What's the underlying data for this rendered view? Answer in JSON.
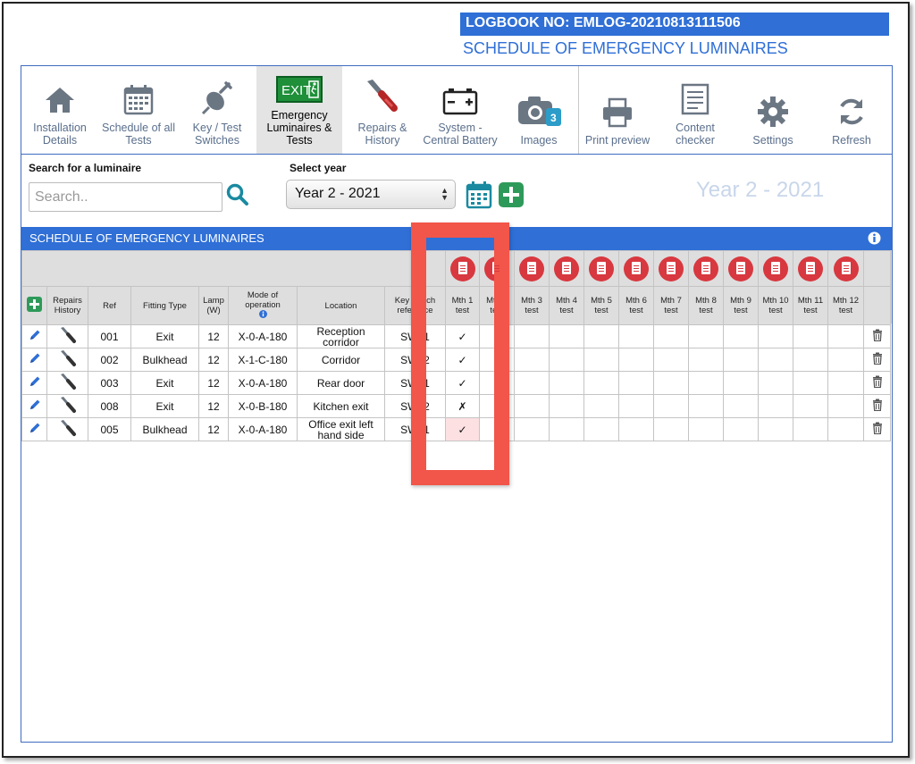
{
  "header": {
    "logbook": "LOGBOOK NO: EMLOG-20210813111506",
    "title": "SCHEDULE OF EMERGENCY LUMINAIRES"
  },
  "toolbar": {
    "items": [
      {
        "label": "Installation Details",
        "icon": "house-icon"
      },
      {
        "label": "Schedule of all Tests",
        "icon": "calendar-icon"
      },
      {
        "label": "Key / Test Switches",
        "icon": "key-switch-icon"
      },
      {
        "label": "Emergency Luminaires & Tests",
        "icon": "exit-sign-icon",
        "active": true
      },
      {
        "label": "Repairs & History",
        "icon": "screwdriver-icon"
      },
      {
        "label": "System - Central Battery",
        "icon": "battery-icon"
      },
      {
        "label": "Images",
        "icon": "camera-icon",
        "badge": "3"
      },
      {
        "label": "Print preview",
        "icon": "printer-icon"
      },
      {
        "label": "Content checker",
        "icon": "checklist-icon"
      },
      {
        "label": "Settings",
        "icon": "gear-icon"
      },
      {
        "label": "Refresh",
        "icon": "refresh-icon"
      }
    ],
    "exit_sign_text": "EXIT"
  },
  "search": {
    "label": "Search for a luminaire",
    "placeholder": "Search.."
  },
  "year": {
    "label": "Select year",
    "selected": "Year 2 - 2021",
    "display": "Year 2 - 2021"
  },
  "section": {
    "title": "SCHEDULE OF EMERGENCY LUMINAIRES"
  },
  "table": {
    "headers": {
      "repairs_history": "Repairs History",
      "ref": "Ref",
      "fitting_type": "Fitting Type",
      "lamp": "Lamp (W)",
      "mode": "Mode of operation",
      "location": "Location",
      "key_switch": "Key switch reference"
    },
    "months": [
      "Mth 1 test",
      "Mth 2 test",
      "Mth 3 test",
      "Mth 4 test",
      "Mth 5 test",
      "Mth 6 test",
      "Mth 7 test",
      "Mth 8 test",
      "Mth 9 test",
      "Mth 10 test",
      "Mth 11 test",
      "Mth 12 test"
    ],
    "rows": [
      {
        "ref": "001",
        "type": "Exit",
        "lamp": "12",
        "mode": "X-0-A-180",
        "location": "Reception corridor",
        "switch": "SW01",
        "m1": "✓",
        "m1_status": "pass"
      },
      {
        "ref": "002",
        "type": "Bulkhead",
        "lamp": "12",
        "mode": "X-1-C-180",
        "location": "Corridor",
        "switch": "SW02",
        "m1": "✓",
        "m1_status": "pass"
      },
      {
        "ref": "003",
        "type": "Exit",
        "lamp": "12",
        "mode": "X-0-A-180",
        "location": "Rear door",
        "switch": "SW01",
        "m1": "✓",
        "m1_status": "pass"
      },
      {
        "ref": "008",
        "type": "Exit",
        "lamp": "12",
        "mode": "X-0-B-180",
        "location": "Kitchen exit",
        "switch": "SW02",
        "m1": "✗",
        "m1_status": "fail"
      },
      {
        "ref": "005",
        "type": "Bulkhead",
        "lamp": "12",
        "mode": "X-0-A-180",
        "location": "Office exit left hand side",
        "switch": "SW01",
        "m1": "✓",
        "m1_status": "pass-highlighted"
      }
    ]
  },
  "colors": {
    "accent": "#2f6fd6",
    "pass": "#1a9a2a",
    "fail": "#e01b1b",
    "highlight": "#f25549",
    "teal": "#1a8aa0",
    "green": "#2e9a5a"
  }
}
